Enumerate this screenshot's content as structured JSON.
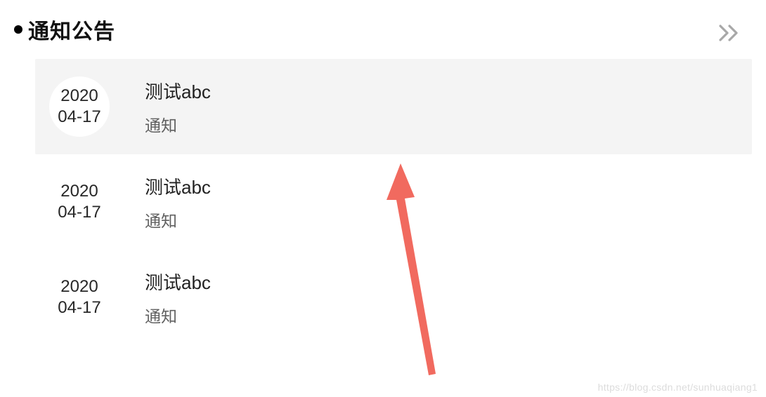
{
  "header": {
    "title": "通知公告"
  },
  "items": [
    {
      "year": "2020",
      "md": "04-17",
      "title": "测试abc",
      "category": "通知"
    },
    {
      "year": "2020",
      "md": "04-17",
      "title": "测试abc",
      "category": "通知"
    },
    {
      "year": "2020",
      "md": "04-17",
      "title": "测试abc",
      "category": "通知"
    }
  ],
  "watermark": "https://blog.csdn.net/sunhuaqiang1"
}
